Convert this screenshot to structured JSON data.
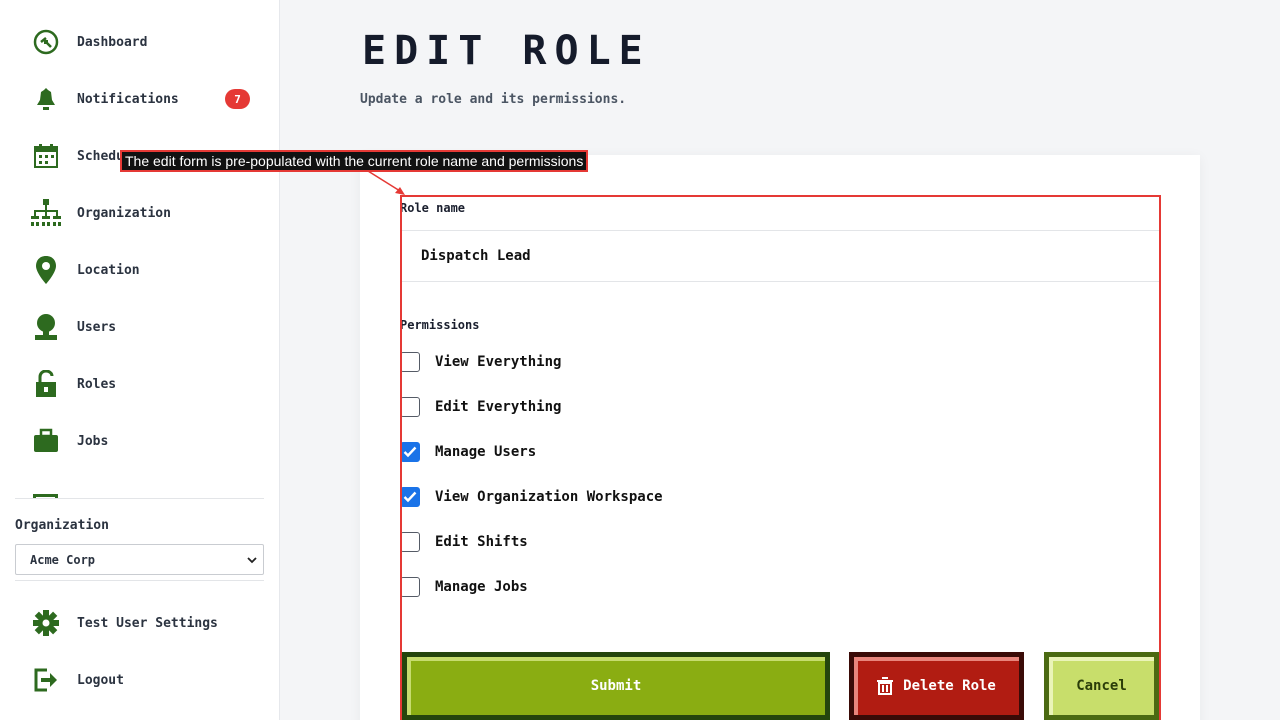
{
  "sidebar": {
    "items": [
      {
        "label": "Dashboard",
        "icon": "dashboard-icon"
      },
      {
        "label": "Notifications",
        "icon": "bell-icon",
        "badge": "7"
      },
      {
        "label": "Schedule",
        "icon": "calendar-icon"
      },
      {
        "label": "Organization",
        "icon": "org-chart-icon"
      },
      {
        "label": "Location",
        "icon": "location-pin-icon"
      },
      {
        "label": "Users",
        "icon": "user-icon"
      },
      {
        "label": "Roles",
        "icon": "lock-icon"
      },
      {
        "label": "Jobs",
        "icon": "briefcase-icon"
      }
    ],
    "org_label": "Organization",
    "org_selected": "Acme Corp",
    "settings_label": "Test User Settings",
    "logout_label": "Logout"
  },
  "main": {
    "title": "EDIT ROLE",
    "subtitle": "Update a role and its permissions."
  },
  "form": {
    "role_name_label": "Role name",
    "role_name_value": "Dispatch Lead",
    "permissions_label": "Permissions",
    "permissions": [
      {
        "label": "View Everything",
        "checked": false
      },
      {
        "label": "Edit Everything",
        "checked": false
      },
      {
        "label": "Manage Users",
        "checked": true
      },
      {
        "label": "View Organization Workspace",
        "checked": true
      },
      {
        "label": "Edit Shifts",
        "checked": false
      },
      {
        "label": "Manage Jobs",
        "checked": false
      }
    ],
    "submit_label": "Submit",
    "delete_label": "Delete Role",
    "cancel_label": "Cancel"
  },
  "annotation": {
    "text": "The edit form is pre-populated with the current role name and permissions"
  },
  "colors": {
    "accent_green": "#8aad12",
    "danger_red": "#b11c12",
    "icon_green": "#2d6a1f",
    "checkbox_blue": "#1a73e8",
    "badge_red": "#e53935"
  }
}
